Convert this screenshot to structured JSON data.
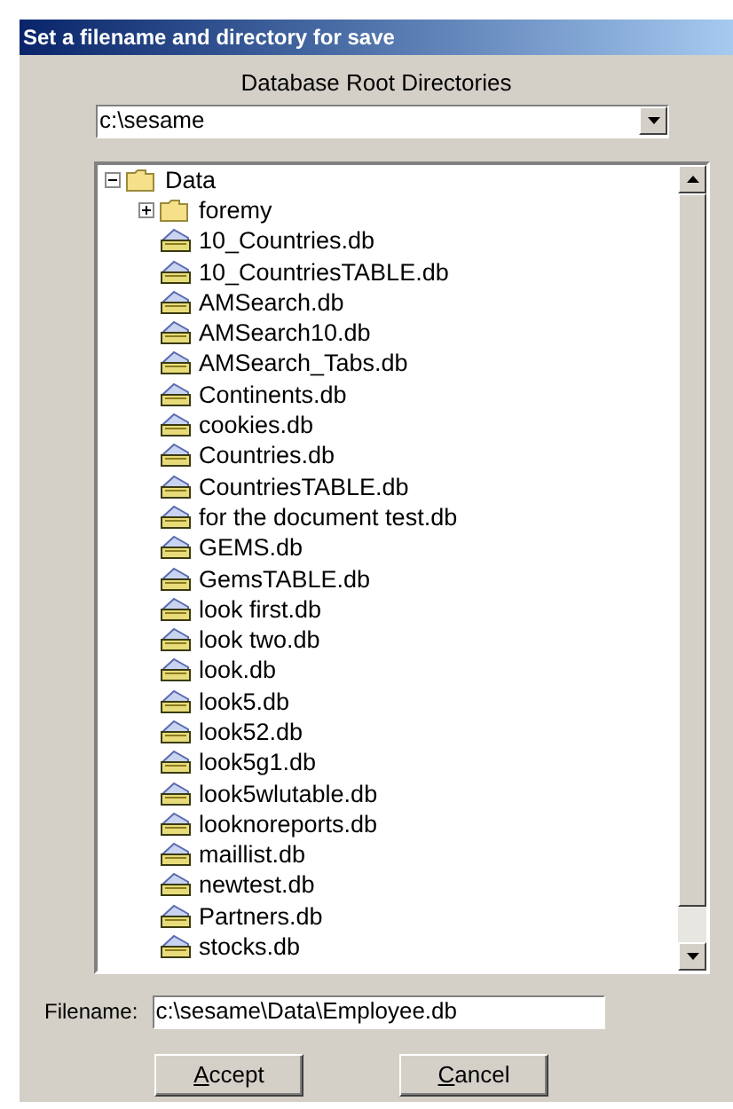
{
  "window": {
    "title": "Set a filename and directory for save"
  },
  "root_directories": {
    "label": "Database Root Directories",
    "value": "c:\\sesame"
  },
  "tree": [
    {
      "label": "Data",
      "kind": "folder",
      "expanded": true,
      "children": [
        {
          "label": "foremy",
          "kind": "folder",
          "expanded": false
        },
        {
          "label": "10_Countries.db",
          "kind": "file"
        },
        {
          "label": "10_CountriesTABLE.db",
          "kind": "file"
        },
        {
          "label": "AMSearch.db",
          "kind": "file"
        },
        {
          "label": "AMSearch10.db",
          "kind": "file"
        },
        {
          "label": "AMSearch_Tabs.db",
          "kind": "file"
        },
        {
          "label": "Continents.db",
          "kind": "file"
        },
        {
          "label": "cookies.db",
          "kind": "file"
        },
        {
          "label": "Countries.db",
          "kind": "file"
        },
        {
          "label": "CountriesTABLE.db",
          "kind": "file"
        },
        {
          "label": "for the document test.db",
          "kind": "file"
        },
        {
          "label": "GEMS.db",
          "kind": "file"
        },
        {
          "label": "GemsTABLE.db",
          "kind": "file"
        },
        {
          "label": "look first.db",
          "kind": "file"
        },
        {
          "label": "look two.db",
          "kind": "file"
        },
        {
          "label": "look.db",
          "kind": "file"
        },
        {
          "label": "look5.db",
          "kind": "file"
        },
        {
          "label": "look52.db",
          "kind": "file"
        },
        {
          "label": "look5g1.db",
          "kind": "file"
        },
        {
          "label": "look5wlutable.db",
          "kind": "file"
        },
        {
          "label": "looknoreports.db",
          "kind": "file"
        },
        {
          "label": "maillist.db",
          "kind": "file"
        },
        {
          "label": "newtest.db",
          "kind": "file"
        },
        {
          "label": "Partners.db",
          "kind": "file"
        },
        {
          "label": "stocks.db",
          "kind": "file"
        }
      ]
    }
  ],
  "filename": {
    "label": "Filename:",
    "value": "c:\\sesame\\Data\\Employee.db"
  },
  "buttons": [
    {
      "label": "Accept",
      "access_key": true
    },
    {
      "label": "Cancel",
      "access_key": true
    }
  ]
}
